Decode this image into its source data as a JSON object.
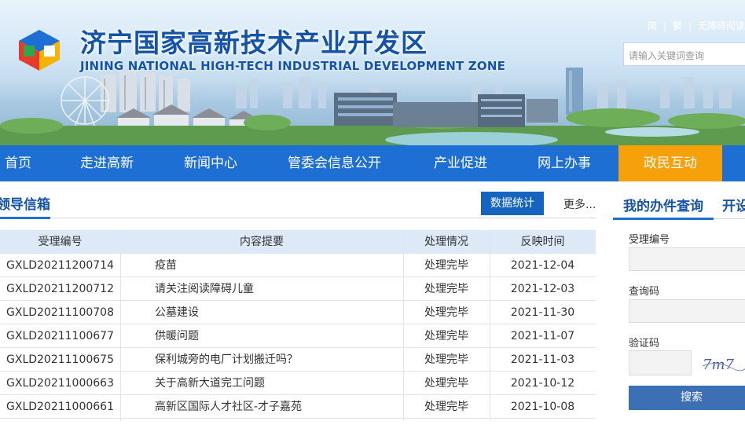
{
  "header": {
    "title": "济宁国家高新技术产业开发区",
    "subtitle": "JINING NATIONAL HIGH-TECH INDUSTRIAL DEVELOPMENT ZONE",
    "logo_icon": "colorful-cube-logo-icon",
    "top_links": [
      "简",
      "繁",
      "无障碍阅读"
    ],
    "search_placeholder": "请输入关键词查询"
  },
  "nav": {
    "items": [
      "首页",
      "走进高新",
      "新闻中心",
      "管委会信息公开",
      "产业促进",
      "网上办事",
      "政民互动"
    ],
    "active": "政民互动",
    "active_color": "#f7a10a",
    "bar_color": "#1e6fd4"
  },
  "mailbox": {
    "title": "领导信箱",
    "stats_button": "数据统计",
    "more_link": "更多...",
    "columns": [
      "受理编号",
      "内容提要",
      "处理情况",
      "反映时间"
    ],
    "rows": [
      {
        "id": "GXLD20211200714",
        "summary": "疫苗",
        "status": "处理完毕",
        "date": "2021-12-04"
      },
      {
        "id": "GXLD20211200712",
        "summary": "请关注阅读障碍儿童",
        "status": "处理完毕",
        "date": "2021-12-03"
      },
      {
        "id": "GXLD20211100708",
        "summary": "公墓建设",
        "status": "处理完毕",
        "date": "2021-11-30"
      },
      {
        "id": "GXLD20211100677",
        "summary": "供暖问题",
        "status": "处理完毕",
        "date": "2021-11-07"
      },
      {
        "id": "GXLD20211100675",
        "summary": "保利城旁的电厂计划搬迁吗？",
        "status": "处理完毕",
        "date": "2021-11-03"
      },
      {
        "id": "GXLD20211000663",
        "summary": "关于高新大道完工问题",
        "status": "处理完毕",
        "date": "2021-10-12"
      },
      {
        "id": "GXLD20211000661",
        "summary": "高新区国际人才社区-才子嘉苑",
        "status": "处理完毕",
        "date": "2021-10-08"
      }
    ]
  },
  "query": {
    "tabs": [
      "我的办件查询",
      "开设"
    ],
    "field_labels": [
      "受理编号",
      "查询码",
      "验证码"
    ],
    "captcha_text": "7m7",
    "search_button": "搜索"
  }
}
